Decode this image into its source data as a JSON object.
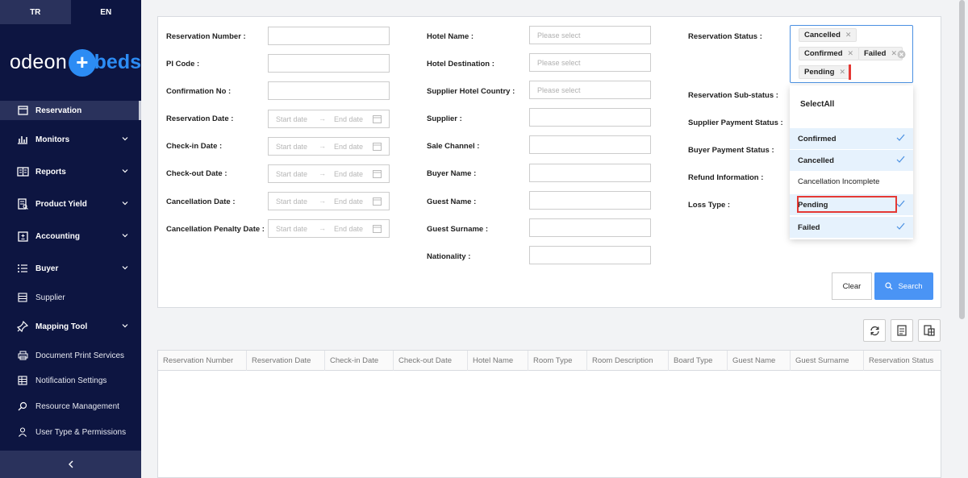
{
  "sidebar": {
    "lang_tr": "TR",
    "lang_en": "EN",
    "logo_left": "odeon",
    "logo_plus": "+",
    "logo_right": "beds",
    "items": [
      {
        "label": "Reservation"
      },
      {
        "label": "Monitors"
      },
      {
        "label": "Reports"
      },
      {
        "label": "Product Yield"
      },
      {
        "label": "Accounting"
      },
      {
        "label": "Buyer"
      },
      {
        "label": "Supplier"
      },
      {
        "label": "Mapping Tool"
      },
      {
        "label": "Document Print Services"
      },
      {
        "label": "Notification Settings"
      },
      {
        "label": "Resource Management"
      },
      {
        "label": "User Type & Permissions"
      }
    ]
  },
  "form": {
    "col1": {
      "reservation_number": "Reservation Number :",
      "pi_code": "PI Code :",
      "confirmation_no": "Confirmation No :",
      "reservation_date": "Reservation Date :",
      "checkin_date": "Check-in Date :",
      "checkout_date": "Check-out Date :",
      "cancellation_date": "Cancellation Date :",
      "cancellation_penalty_date": "Cancellation Penalty Date :"
    },
    "col2": {
      "hotel_name": "Hotel Name :",
      "hotel_destination": "Hotel Destination :",
      "supplier_hotel_country": "Supplier Hotel Country :",
      "supplier": "Supplier :",
      "sale_channel": "Sale Channel :",
      "buyer_name": "Buyer Name :",
      "guest_name": "Guest Name :",
      "guest_surname": "Guest Surname :",
      "nationality": "Nationality :"
    },
    "col3": {
      "reservation_status": "Reservation Status :",
      "reservation_substatus": "Reservation Sub-status :",
      "supplier_payment_status": "Supplier Payment Status :",
      "buyer_payment_status": "Buyer Payment Status :",
      "refund_information": "Refund Information :",
      "loss_type": "Loss Type :"
    },
    "placeholders": {
      "please_select": "Please select",
      "start_date": "Start date",
      "end_date": "End date"
    },
    "status_chips": [
      "Cancelled",
      "Confirmed",
      "Failed",
      "Pending"
    ],
    "dropdown": {
      "select_all": "SelectAll",
      "options": [
        {
          "label": "Confirmed",
          "selected": true
        },
        {
          "label": "Cancelled",
          "selected": true
        },
        {
          "label": "Cancellation Incomplete",
          "selected": false
        },
        {
          "label": "Pending",
          "selected": true
        },
        {
          "label": "Failed",
          "selected": true
        }
      ]
    },
    "clear_label": "Clear",
    "search_label": "Search"
  },
  "table": {
    "columns": [
      "Reservation Number",
      "Reservation Date",
      "Check-in Date",
      "Check-out Date",
      "Hotel Name",
      "Room Type",
      "Room Description",
      "Board Type",
      "Guest Name",
      "Guest Surname",
      "Reservation Status"
    ]
  },
  "colors": {
    "sidebar_bg": "#0d1541",
    "accent": "#4a94f5",
    "highlight_red": "#e53935"
  }
}
